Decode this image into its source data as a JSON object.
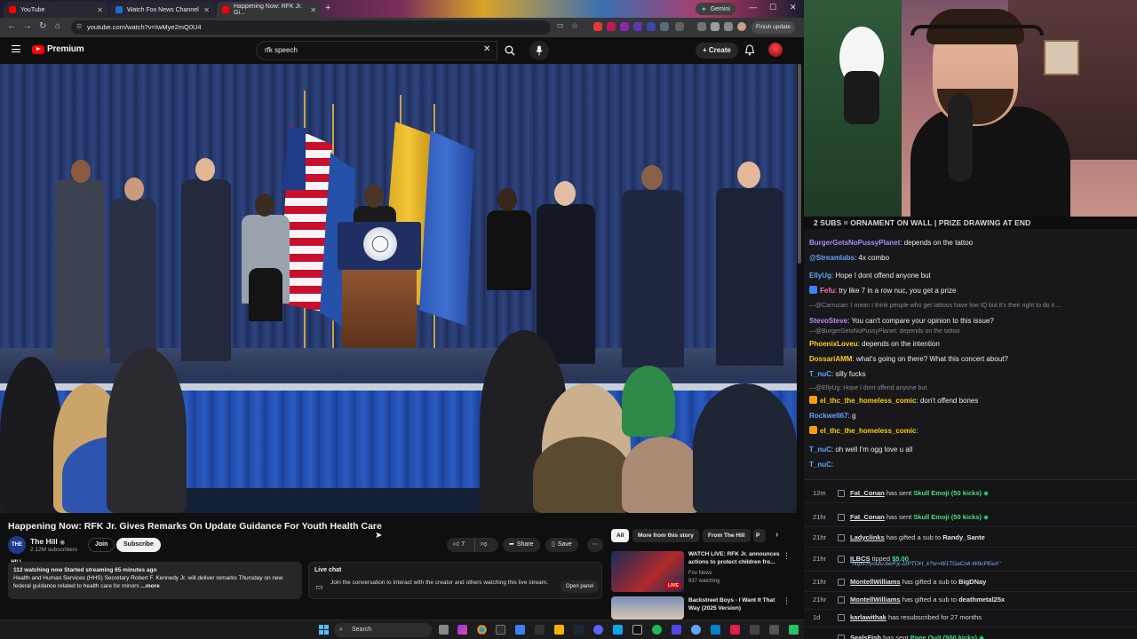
{
  "browser": {
    "tabs": [
      {
        "label": "YouTube",
        "color": "#ff0000"
      },
      {
        "label": "Watch Fox News Channel",
        "color": "#1c6cd8"
      },
      {
        "label": "Happening Now: RFK Jr. Gi...",
        "color": "#ff0000"
      }
    ],
    "gemini_label": "Gemini",
    "url": "youtube.com/watch?v=IwMye2mQ0U4",
    "finish_update": "Finish update",
    "new_tab": "+"
  },
  "youtube": {
    "brand": "Premium",
    "search_query": "rfk speech",
    "create_label": "Create",
    "video_title": "Happening Now: RFK Jr. Gives Remarks On Update Guidance For Youth Health Care",
    "channel": {
      "name": "The Hill",
      "avatar_text": "THE HILL",
      "subscribers": "2.12M subscribers",
      "join_label": "Join",
      "subscribe_label": "Subscribe"
    },
    "actions": {
      "likes": "7",
      "share": "Share",
      "save": "Save"
    },
    "description": {
      "meta": "112 watching now  Started streaming 65 minutes ago",
      "text": "Health and Human Services (HHS) Secretary Robert F. Kennedy Jr. will deliver remarks Thursday on new federal guidance related to health care for minors",
      "more": "...more"
    },
    "live_chat": {
      "title": "Live chat",
      "text": "Join the conversation to interact with the creator and others watching this live stream.",
      "open_panel": "Open panel"
    },
    "chips": [
      "All",
      "More from this story",
      "From The Hill",
      "P"
    ],
    "recommendations": [
      {
        "title": "WATCH LIVE: RFK Jr. announces actions to protect children fro...",
        "channel": "Fox News",
        "meta": "937 watching",
        "badge": "LIVE"
      },
      {
        "title": "Backstreet Boys - I Want It That Way (2025 Version)",
        "channel": "",
        "meta": "",
        "badge": ""
      }
    ]
  },
  "taskbar": {
    "search_placeholder": "Search"
  },
  "stream": {
    "banner": "2 SUBS = ORNAMENT ON WALL | PRIZE DRAWING AT END"
  },
  "chat": [
    {
      "user": "BurgerGetsNoPussyPlanet",
      "color": "#a78bfa",
      "text": ": depends on the tattoo",
      "reply": false,
      "badge": ""
    },
    {
      "user": "@Streamlabs",
      "color": "#60a5fa",
      "text": ": 4x  combo",
      "reply": false,
      "badge": ""
    },
    {
      "user": "EllyUg",
      "color": "#60a5fa",
      "text": ": Hope I dont offend anyone but",
      "reply": false,
      "badge": ""
    },
    {
      "user": "Fefu",
      "color": "#f472b6",
      "text": ": try like 7 in a row nuc, you get a prize",
      "reply": false,
      "badge": "#3b82f6"
    },
    {
      "user": "",
      "color": "#8a8a8f",
      "text": "—@Carrucan: I mean I think people who get tattoos have low IQ but it's their right to do it ...",
      "reply": true,
      "badge": ""
    },
    {
      "user": "StevoSteve",
      "color": "#c084fc",
      "text": ": You can't compare your opinion to this issue?",
      "reply": false,
      "badge": ""
    },
    {
      "user": "",
      "color": "#8a8a8f",
      "text": "—@BurgerGetsNoPussyPlanet: depends on the tattoo",
      "reply": true,
      "badge": ""
    },
    {
      "user": "PhoenixLoveu",
      "color": "#facc15",
      "text": ": depends on the intention",
      "reply": false,
      "badge": ""
    },
    {
      "user": "DossariAMM",
      "color": "#facc15",
      "text": ": what's going on there? What this concert about?",
      "reply": false,
      "badge": ""
    },
    {
      "user": "T_nuC",
      "color": "#60a5fa",
      "text": ": silly fucks",
      "reply": false,
      "badge": ""
    },
    {
      "user": "",
      "color": "#8a8a8f",
      "text": "—@EllyUg: Hope I dont offend anyone but",
      "reply": true,
      "badge": ""
    },
    {
      "user": "el_thc_the_homeless_comic",
      "color": "#facc15",
      "text": ": don't offend bones",
      "reply": false,
      "badge": "#f59e0b"
    },
    {
      "user": "Rockwell67",
      "color": "#60a5fa",
      "text": ": g",
      "reply": false,
      "badge": ""
    },
    {
      "user": "el_thc_the_homeless_comic",
      "color": "#facc15",
      "text": ":",
      "reply": false,
      "badge": "#f59e0b"
    },
    {
      "user": "T_nuC",
      "color": "#60a5fa",
      "text": ": oh well I'm ogg love u all",
      "reply": false,
      "badge": ""
    },
    {
      "user": "T_nuC",
      "color": "#60a5fa",
      "text": ":",
      "reply": false,
      "badge": ""
    }
  ],
  "events": [
    {
      "time": "12m",
      "user": "Fat_Conan",
      "pre": " has sent ",
      "highlight": "Skull Emoji (50 kicks)",
      "post": "",
      "second": ""
    },
    {
      "time": "21hr",
      "user": "Fat_Conan",
      "pre": " has sent ",
      "highlight": "Skull Emoji (50 kicks)",
      "post": "",
      "second": ""
    },
    {
      "time": "21hr",
      "user": "Ladyclinks",
      "pre": " has gifted a sub to ",
      "highlight": "",
      "post": "Randy_Sante",
      "second": ""
    },
    {
      "time": "21hr",
      "user": "ILBCS",
      "pre": " tipped ",
      "highlight": "$5.00",
      "post": "",
      "second": "\"https://youtu.be/FjLJ2PTOH_k?si=W1TGaCok-W9cPEeA\""
    },
    {
      "time": "21hr",
      "user": "MontellWilliams",
      "pre": " has gifted a sub to ",
      "highlight": "",
      "post": "BigDNay",
      "second": ""
    },
    {
      "time": "21hr",
      "user": "MontellWilliams",
      "pre": " has gifted a sub to ",
      "highlight": "",
      "post": "deathmetal25x",
      "second": ""
    },
    {
      "time": "1d",
      "user": "karlawithak",
      "pre": " has resubscribed for 27 months",
      "highlight": "",
      "post": "",
      "second": ""
    },
    {
      "time": "",
      "user": "SealsFish",
      "pre": " has sent ",
      "highlight": "Page Quit (500 kicks)",
      "post": "",
      "second": ""
    }
  ]
}
